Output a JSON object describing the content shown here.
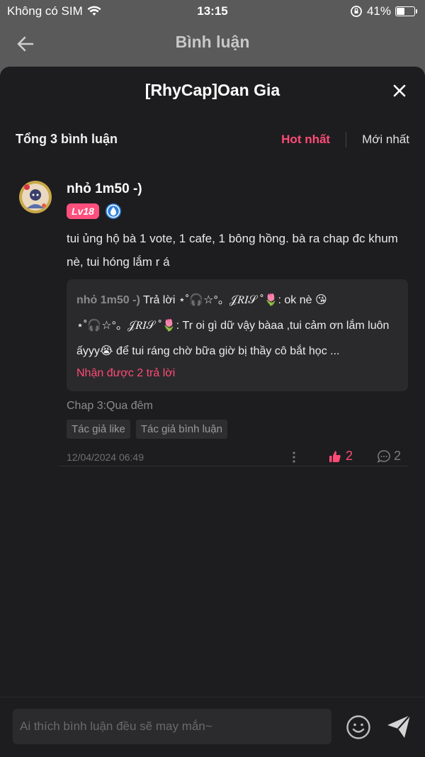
{
  "status_bar": {
    "carrier": "Không có SIM",
    "time": "13:15",
    "battery": "41%",
    "battery_level": 0.41
  },
  "nav": {
    "title": "Bình luận"
  },
  "sheet": {
    "title": "[RhyCap]Oan Gia",
    "count_label": "Tổng 3 bình luận",
    "sort_hot": "Hot nhất",
    "sort_new": "Mới nhất"
  },
  "comment": {
    "author": "nhỏ 1m50 -)",
    "level": "Lv18",
    "text": "tui ủng hộ bà 1 vote, 1 cafe, 1 bông hồng. bà ra chap đc khum nè, tui hóng lắm r á",
    "replies": [
      {
        "author": "nhỏ 1m50 -)",
        "prefix": " Trả lời ",
        "target": "⋆˚🎧☆°。𝒥𝑅𝐼𝒮 ˚🌷",
        "content": ": ok nè 😘"
      },
      {
        "author": "⋆˚🎧☆°。𝒥𝑅𝐼𝒮 ˚🌷",
        "prefix": "",
        "target": "",
        "content": ": Tr oi gì dữ vậy bàaa ,tui cảm ơn lắm luôn ấyyy😭 để tui ráng chờ bữa giờ bị thầy cô bắt học ..."
      }
    ],
    "reply_link": "Nhận được 2 trả lời",
    "chapter": "Chap 3:Qua đêm",
    "tags": [
      "Tác giả like",
      "Tác giả bình luận"
    ],
    "date": "12/04/2024 06:49",
    "like_count": "2",
    "reply_count": "2"
  },
  "input": {
    "placeholder": "Ai thích bình luận đều sẽ may mắn~"
  },
  "colors": {
    "accent": "#ff4b77",
    "sheet_bg": "#1d1d1f",
    "overlay": "#5a5a5a"
  }
}
